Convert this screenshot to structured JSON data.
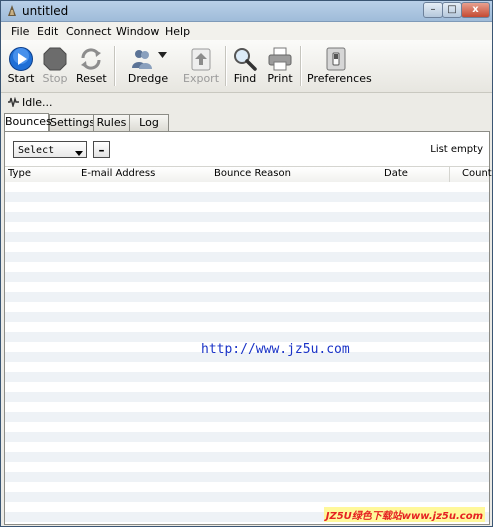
{
  "window": {
    "title": "untitled",
    "min_label": "–",
    "max_label": "□",
    "close_label": "x"
  },
  "menu": [
    "File",
    "Edit",
    "Connect",
    "Window",
    "Help"
  ],
  "toolbar": {
    "start": "Start",
    "stop": "Stop",
    "reset": "Reset",
    "dredge": "Dredge",
    "export": "Export",
    "find": "Find",
    "print": "Print",
    "preferences": "Preferences"
  },
  "status": {
    "text": "Idle..."
  },
  "tabs": [
    "Bounces",
    "Settings",
    "Rules",
    "Log"
  ],
  "controls": {
    "select_value": "Select",
    "minus_label": "–",
    "list_status": "List empty"
  },
  "table": {
    "columns": [
      "Type",
      "E-mail Address",
      "Bounce Reason",
      "Date",
      "Count"
    ]
  },
  "watermark": {
    "url": "http://www.jz5u.com",
    "footer": "JZ5U绿色下载站www.jz5u.com"
  },
  "colors": {
    "accent": "#1f6fd6",
    "watermark_text": "#1a33c7",
    "footer_text": "#e52222"
  }
}
